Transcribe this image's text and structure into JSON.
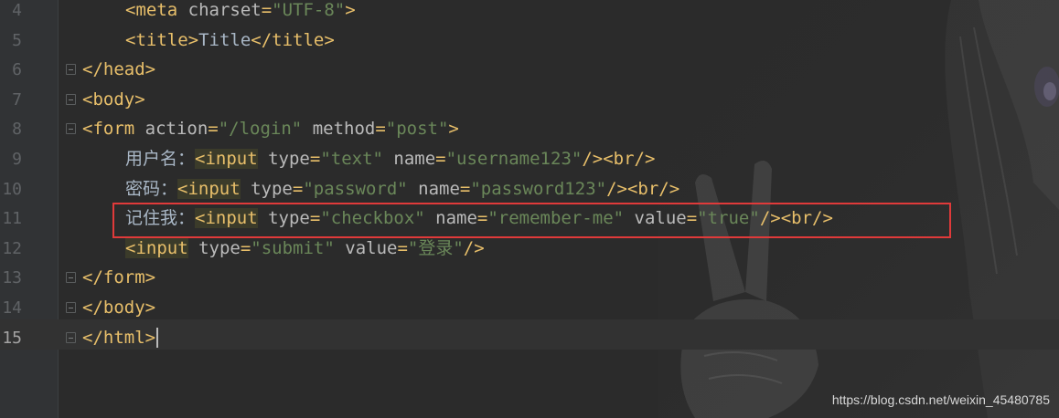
{
  "editor": {
    "lines": [
      {
        "num": "4",
        "parts": [
          [
            "tag",
            "<meta "
          ],
          [
            "attr",
            "charset"
          ],
          [
            "tag",
            "="
          ],
          [
            "val",
            "\"UTF-8\""
          ],
          [
            "tag",
            ">"
          ]
        ],
        "indent": "    "
      },
      {
        "num": "5",
        "parts": [
          [
            "tag",
            "<title>"
          ],
          [
            "txt",
            "Title"
          ],
          [
            "tag",
            "</title>"
          ]
        ],
        "indent": "    "
      },
      {
        "num": "6",
        "parts": [
          [
            "tag",
            "</head>"
          ]
        ],
        "indent": ""
      },
      {
        "num": "7",
        "parts": [
          [
            "tag",
            "<body>"
          ]
        ],
        "indent": ""
      },
      {
        "num": "8",
        "parts": [
          [
            "tag",
            "<form "
          ],
          [
            "attr",
            "action"
          ],
          [
            "tag",
            "="
          ],
          [
            "val",
            "\"/login\""
          ],
          [
            "attr",
            " method"
          ],
          [
            "tag",
            "="
          ],
          [
            "val",
            "\"post\""
          ],
          [
            "tag",
            ">"
          ]
        ],
        "indent": ""
      },
      {
        "num": "9",
        "parts": [
          [
            "txt",
            "用户名："
          ],
          [
            "tag",
            "<input"
          ],
          [
            "attr",
            " type"
          ],
          [
            "tag",
            "="
          ],
          [
            "val",
            "\"text\""
          ],
          [
            "attr",
            " name"
          ],
          [
            "tag",
            "="
          ],
          [
            "val",
            "\"username123\""
          ],
          [
            "tag",
            "/><br/>"
          ]
        ],
        "indent": "    "
      },
      {
        "num": "10",
        "parts": [
          [
            "txt",
            "密码："
          ],
          [
            "tag",
            "<input"
          ],
          [
            "attr",
            " type"
          ],
          [
            "tag",
            "="
          ],
          [
            "val",
            "\"password\""
          ],
          [
            "attr",
            " name"
          ],
          [
            "tag",
            "="
          ],
          [
            "val",
            "\"password123\""
          ],
          [
            "tag",
            "/><br/>"
          ]
        ],
        "indent": "    "
      },
      {
        "num": "11",
        "parts": [
          [
            "txt",
            "记住我："
          ],
          [
            "tag",
            "<input"
          ],
          [
            "attr",
            " type"
          ],
          [
            "tag",
            "="
          ],
          [
            "val",
            "\"checkbox\""
          ],
          [
            "attr",
            " name"
          ],
          [
            "tag",
            "="
          ],
          [
            "val",
            "\"remember-me\""
          ],
          [
            "attr",
            " value"
          ],
          [
            "tag",
            "="
          ],
          [
            "val",
            "\"true\""
          ],
          [
            "tag",
            "/><br/>"
          ]
        ],
        "indent": "    "
      },
      {
        "num": "12",
        "parts": [
          [
            "tag",
            "<input"
          ],
          [
            "attr",
            " type"
          ],
          [
            "tag",
            "="
          ],
          [
            "val",
            "\"submit\""
          ],
          [
            "attr",
            " value"
          ],
          [
            "tag",
            "="
          ],
          [
            "val",
            "\"登录\""
          ],
          [
            "tag",
            "/>"
          ]
        ],
        "indent": "    "
      },
      {
        "num": "13",
        "parts": [
          [
            "tag",
            "</form>"
          ]
        ],
        "indent": ""
      },
      {
        "num": "14",
        "parts": [
          [
            "tag",
            "</body>"
          ]
        ],
        "indent": ""
      },
      {
        "num": "15",
        "parts": [
          [
            "tag",
            "</html>"
          ]
        ],
        "indent": ""
      }
    ],
    "active_line": "15"
  },
  "watermark": "https://blog.csdn.net/weixin_45480785",
  "colors": {
    "background": "#2b2b2b",
    "tag": "#e8bf6a",
    "attribute": "#bababa",
    "string": "#6a8759",
    "highlight_box": "#e03a3a"
  }
}
